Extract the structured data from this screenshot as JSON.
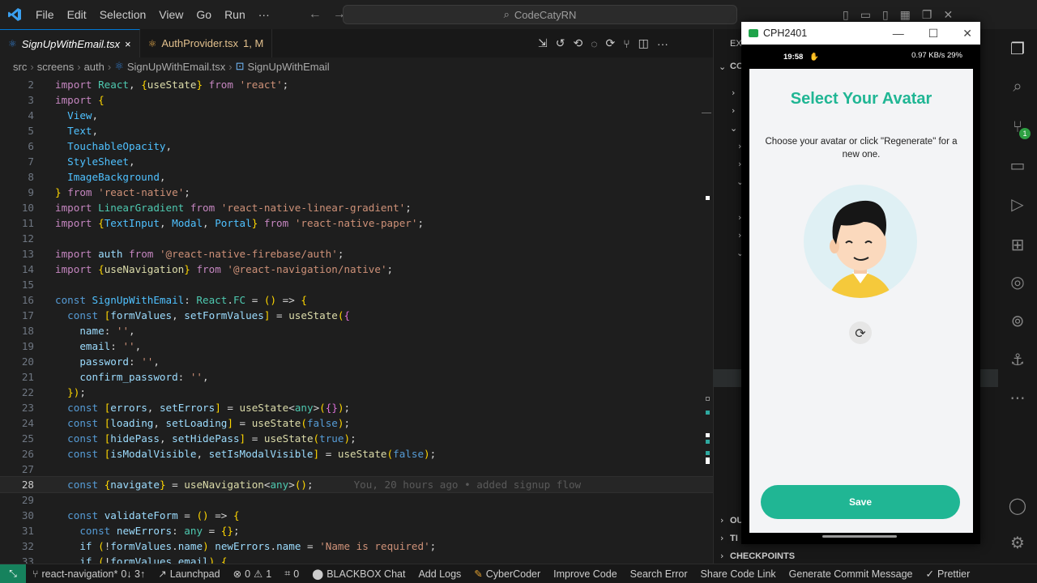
{
  "titlebar": {
    "menu": [
      "File",
      "Edit",
      "Selection",
      "View",
      "Go",
      "Run",
      "···"
    ],
    "search": "CodeCatyRN"
  },
  "tabs": [
    {
      "label": "SignUpWithEmail.tsx",
      "close": "×"
    },
    {
      "label": "AuthProvider.tsx",
      "status": "1, M"
    }
  ],
  "breadcrumb": [
    "src",
    "screens",
    "auth",
    "SignUpWithEmail.tsx",
    "SignUpWithEmail"
  ],
  "editor": {
    "current_line": 28,
    "blame": "You, 20 hours ago • added signup flow",
    "lines": [
      {
        "n": "2",
        "code": "import React, {useState} from 'react';"
      },
      {
        "n": "3",
        "code": "import {"
      },
      {
        "n": "4",
        "code": "  View,"
      },
      {
        "n": "5",
        "code": "  Text,"
      },
      {
        "n": "6",
        "code": "  TouchableOpacity,"
      },
      {
        "n": "7",
        "code": "  StyleSheet,"
      },
      {
        "n": "8",
        "code": "  ImageBackground,"
      },
      {
        "n": "9",
        "code": "} from 'react-native';"
      },
      {
        "n": "10",
        "code": "import LinearGradient from 'react-native-linear-gradient';"
      },
      {
        "n": "11",
        "code": "import {TextInput, Modal, Portal} from 'react-native-paper';"
      },
      {
        "n": "12",
        "code": ""
      },
      {
        "n": "13",
        "code": "import auth from '@react-native-firebase/auth';"
      },
      {
        "n": "14",
        "code": "import {useNavigation} from '@react-navigation/native';"
      },
      {
        "n": "15",
        "code": ""
      },
      {
        "n": "16",
        "code": "const SignUpWithEmail: React.FC = () => {"
      },
      {
        "n": "17",
        "code": "  const [formValues, setFormValues] = useState({"
      },
      {
        "n": "18",
        "code": "    name: '',"
      },
      {
        "n": "19",
        "code": "    email: '',"
      },
      {
        "n": "20",
        "code": "    password: '',"
      },
      {
        "n": "21",
        "code": "    confirm_password: '',"
      },
      {
        "n": "22",
        "code": "  });"
      },
      {
        "n": "23",
        "code": "  const [errors, setErrors] = useState<any>({});"
      },
      {
        "n": "24",
        "code": "  const [loading, setLoading] = useState(false);"
      },
      {
        "n": "25",
        "code": "  const [hidePass, setHidePass] = useState(true);"
      },
      {
        "n": "26",
        "code": "  const [isModalVisible, setIsModalVisible] = useState(false);"
      },
      {
        "n": "27",
        "code": ""
      },
      {
        "n": "28",
        "code": "  const {navigate} = useNavigation<any>();"
      },
      {
        "n": "29",
        "code": ""
      },
      {
        "n": "30",
        "code": "  const validateForm = () => {"
      },
      {
        "n": "31",
        "code": "    const newErrors: any = {};"
      },
      {
        "n": "32",
        "code": "    if (!formValues.name) newErrors.name = 'Name is required';"
      },
      {
        "n": "33",
        "code": "    if (!formValues.email) {"
      }
    ]
  },
  "side_panel": {
    "header": "EX",
    "sections": [
      "CO",
      "OU",
      "TI",
      "CHECKPOINTS"
    ]
  },
  "activity_bar": {
    "scm_badge": "1",
    "items": [
      "explorer-icon",
      "search-icon",
      "source-control-icon",
      "folder-icon",
      "run-debug-icon",
      "extensions-icon",
      "git-graph-icon",
      "remote-icon",
      "anchor-icon",
      "more-icon",
      "account-icon",
      "settings-icon"
    ]
  },
  "statusbar": {
    "branch": "react-navigation*",
    "sync": "0↓ 3↑",
    "launchpad": "Launchpad",
    "errors": "0",
    "warnings": "1",
    "ports": "0",
    "items": [
      "BLACKBOX Chat",
      "Add Logs",
      "CyberCoder",
      "Improve Code",
      "Search Error",
      "Share Code Link",
      "Generate Commit Message"
    ],
    "prettier": "Prettier"
  },
  "phone": {
    "window_title": "CPH2401",
    "status_time": "19:58",
    "status_right": "0.97 KB/s  29%",
    "screen_title": "Select Your Avatar",
    "screen_subtitle": "Choose your avatar or click \"Regenerate\" for a new one.",
    "save_label": "Save"
  },
  "colors": {
    "accent": "#20b694",
    "editor_bg": "#1e1e1e",
    "remote_green": "#16825d"
  }
}
